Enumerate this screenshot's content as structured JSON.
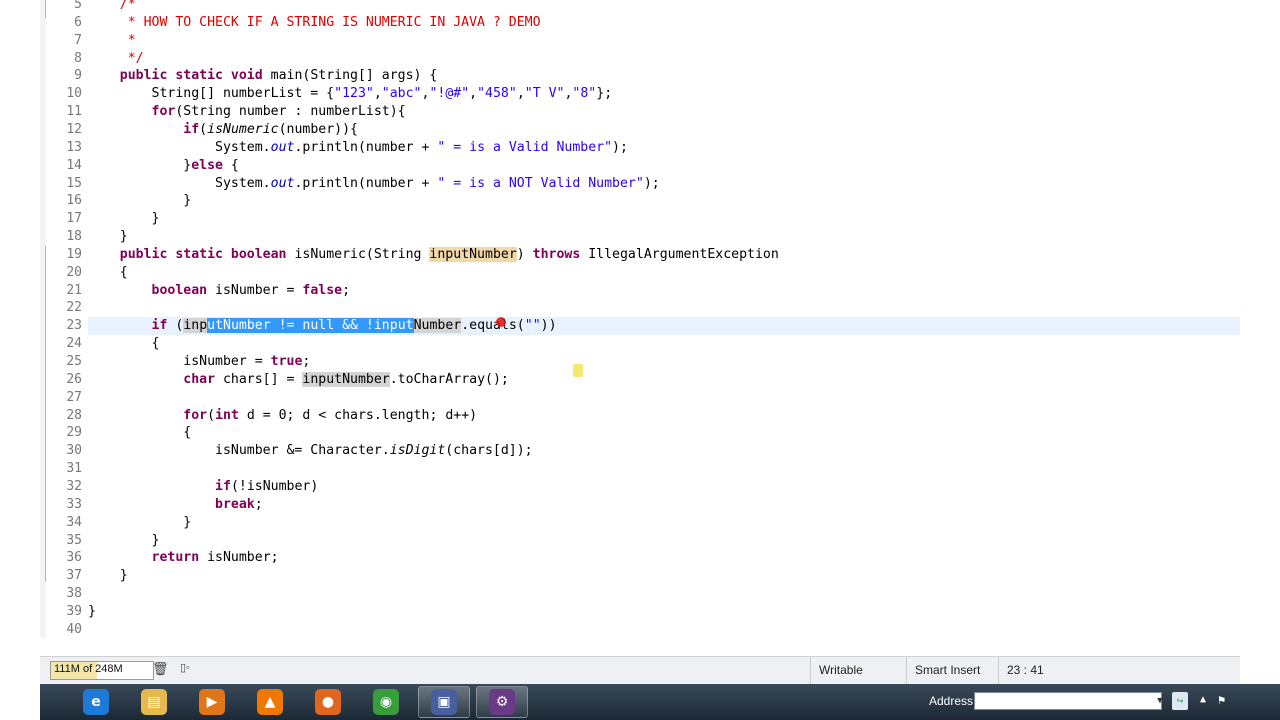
{
  "editor": {
    "lines": [
      {
        "n": 5,
        "segs": [
          {
            "t": "    "
          },
          {
            "t": "/*",
            "c": "c"
          }
        ]
      },
      {
        "n": 6,
        "segs": [
          {
            "t": "     "
          },
          {
            "t": "* HOW TO CHECK IF A STRING IS NUMERIC IN JAVA ? DEMO",
            "c": "c"
          }
        ]
      },
      {
        "n": 7,
        "segs": [
          {
            "t": "     "
          },
          {
            "t": "*",
            "c": "c"
          }
        ]
      },
      {
        "n": 8,
        "segs": [
          {
            "t": "     "
          },
          {
            "t": "*/",
            "c": "c"
          }
        ]
      },
      {
        "n": 9,
        "segs": [
          {
            "t": "    "
          },
          {
            "t": "public static void",
            "c": "k"
          },
          {
            "t": " main(String[] args) {"
          }
        ]
      },
      {
        "n": 10,
        "segs": [
          {
            "t": "        String[] numberList = {"
          },
          {
            "t": "\"123\"",
            "c": "s"
          },
          {
            "t": ","
          },
          {
            "t": "\"abc\"",
            "c": "s"
          },
          {
            "t": ","
          },
          {
            "t": "\"!@#\"",
            "c": "s"
          },
          {
            "t": ","
          },
          {
            "t": "\"458\"",
            "c": "s"
          },
          {
            "t": ","
          },
          {
            "t": "\"T V\"",
            "c": "s"
          },
          {
            "t": ","
          },
          {
            "t": "\"8\"",
            "c": "s"
          },
          {
            "t": "};"
          }
        ]
      },
      {
        "n": 11,
        "segs": [
          {
            "t": "        "
          },
          {
            "t": "for",
            "c": "k"
          },
          {
            "t": "(String number : numberList){"
          }
        ]
      },
      {
        "n": 12,
        "segs": [
          {
            "t": "            "
          },
          {
            "t": "if",
            "c": "k"
          },
          {
            "t": "("
          },
          {
            "t": "isNumeric",
            "c": "i"
          },
          {
            "t": "(number)){"
          }
        ]
      },
      {
        "n": 13,
        "segs": [
          {
            "t": "                System."
          },
          {
            "t": "out",
            "c": "pi"
          },
          {
            "t": ".println(number + "
          },
          {
            "t": "\" = is a Valid Number\"",
            "c": "s"
          },
          {
            "t": ");"
          }
        ]
      },
      {
        "n": 14,
        "segs": [
          {
            "t": "            }"
          },
          {
            "t": "else",
            "c": "k"
          },
          {
            "t": " {"
          }
        ]
      },
      {
        "n": 15,
        "segs": [
          {
            "t": "                System."
          },
          {
            "t": "out",
            "c": "pi"
          },
          {
            "t": ".println(number + "
          },
          {
            "t": "\" = is a NOT Valid Number\"",
            "c": "s"
          },
          {
            "t": ");"
          }
        ]
      },
      {
        "n": 16,
        "segs": [
          {
            "t": "            }"
          }
        ]
      },
      {
        "n": 17,
        "segs": [
          {
            "t": "        }"
          }
        ]
      },
      {
        "n": 18,
        "segs": [
          {
            "t": "    }"
          }
        ]
      },
      {
        "n": 19,
        "segs": [
          {
            "t": "    "
          },
          {
            "t": "public static boolean",
            "c": "k"
          },
          {
            "t": " isNumeric(String "
          },
          {
            "t": "inputNumber",
            "c": "mk"
          },
          {
            "t": ") "
          },
          {
            "t": "throws",
            "c": "k"
          },
          {
            "t": " IllegalArgumentException"
          }
        ]
      },
      {
        "n": 20,
        "segs": [
          {
            "t": "    {"
          }
        ]
      },
      {
        "n": 21,
        "segs": [
          {
            "t": "        "
          },
          {
            "t": "boolean",
            "c": "k"
          },
          {
            "t": " isNumber = "
          },
          {
            "t": "false",
            "c": "k"
          },
          {
            "t": ";"
          }
        ]
      },
      {
        "n": 22,
        "segs": [
          {
            "t": ""
          }
        ]
      },
      {
        "n": 23,
        "cur": true,
        "segs": [
          {
            "t": "        "
          },
          {
            "t": "if",
            "c": "k"
          },
          {
            "t": " ("
          },
          {
            "t": "inp",
            "c": "mg"
          },
          {
            "t": "utNumber != null && !input",
            "c": "sel"
          },
          {
            "t": "Number",
            "c": "mg"
          },
          {
            "t": ".equals("
          },
          {
            "t": "\"\"",
            "c": "s"
          },
          {
            "t": "))"
          }
        ]
      },
      {
        "n": 24,
        "segs": [
          {
            "t": "        {"
          }
        ]
      },
      {
        "n": 25,
        "segs": [
          {
            "t": "            isNumber = "
          },
          {
            "t": "true",
            "c": "k"
          },
          {
            "t": ";"
          }
        ]
      },
      {
        "n": 26,
        "segs": [
          {
            "t": "            "
          },
          {
            "t": "char",
            "c": "k"
          },
          {
            "t": " chars[] = "
          },
          {
            "t": "inputNumber",
            "c": "mg"
          },
          {
            "t": ".toCharArray();"
          }
        ]
      },
      {
        "n": 27,
        "segs": [
          {
            "t": ""
          }
        ]
      },
      {
        "n": 28,
        "segs": [
          {
            "t": "            "
          },
          {
            "t": "for",
            "c": "k"
          },
          {
            "t": "("
          },
          {
            "t": "int",
            "c": "k"
          },
          {
            "t": " d = 0; d < chars.length; d++)"
          }
        ]
      },
      {
        "n": 29,
        "segs": [
          {
            "t": "            {"
          }
        ]
      },
      {
        "n": 30,
        "segs": [
          {
            "t": "                isNumber &= Character."
          },
          {
            "t": "isDigit",
            "c": "i"
          },
          {
            "t": "(chars[d]);"
          }
        ]
      },
      {
        "n": 31,
        "segs": [
          {
            "t": ""
          }
        ]
      },
      {
        "n": 32,
        "segs": [
          {
            "t": "                "
          },
          {
            "t": "if",
            "c": "k"
          },
          {
            "t": "(!isNumber)"
          }
        ]
      },
      {
        "n": 33,
        "segs": [
          {
            "t": "                "
          },
          {
            "t": "break",
            "c": "k"
          },
          {
            "t": ";"
          }
        ]
      },
      {
        "n": 34,
        "segs": [
          {
            "t": "            }"
          }
        ]
      },
      {
        "n": 35,
        "segs": [
          {
            "t": "        }"
          }
        ]
      },
      {
        "n": 36,
        "segs": [
          {
            "t": "        "
          },
          {
            "t": "return",
            "c": "k"
          },
          {
            "t": " isNumber;"
          }
        ]
      },
      {
        "n": 37,
        "segs": [
          {
            "t": "    }"
          }
        ]
      },
      {
        "n": 38,
        "segs": [
          {
            "t": ""
          }
        ]
      },
      {
        "n": 39,
        "segs": [
          {
            "t": "}"
          }
        ]
      },
      {
        "n": 40,
        "segs": [
          {
            "t": ""
          }
        ]
      }
    ]
  },
  "status_bar": {
    "heap_used": "111M",
    "heap_total": "of 248M",
    "heap_fraction": 0.45,
    "gc_icon": "trash-icon",
    "heap_icon": "heap-status-icon",
    "mode": "Writable",
    "insert_mode": "Smart Insert",
    "position": "23 : 41"
  },
  "taskbar": {
    "apps": [
      {
        "name": "ie-icon",
        "glyph": "e",
        "color": "#1e7ad6"
      },
      {
        "name": "folder-icon",
        "glyph": "▤",
        "color": "#e7b94a"
      },
      {
        "name": "media-player-icon",
        "glyph": "▶",
        "color": "#e0761a"
      },
      {
        "name": "vlc-icon",
        "glyph": "▲",
        "color": "#f07800"
      },
      {
        "name": "firefox-icon",
        "glyph": "●",
        "color": "#e0661f"
      },
      {
        "name": "chrome-icon",
        "glyph": "◉",
        "color": "#3a9d3c"
      },
      {
        "name": "save-disk-icon",
        "glyph": "▣",
        "color": "#4a5fa0"
      },
      {
        "name": "java-ee-ide-icon",
        "glyph": "⚙",
        "color": "#6a3a88"
      }
    ],
    "address_label": "Address",
    "address_value": ""
  }
}
